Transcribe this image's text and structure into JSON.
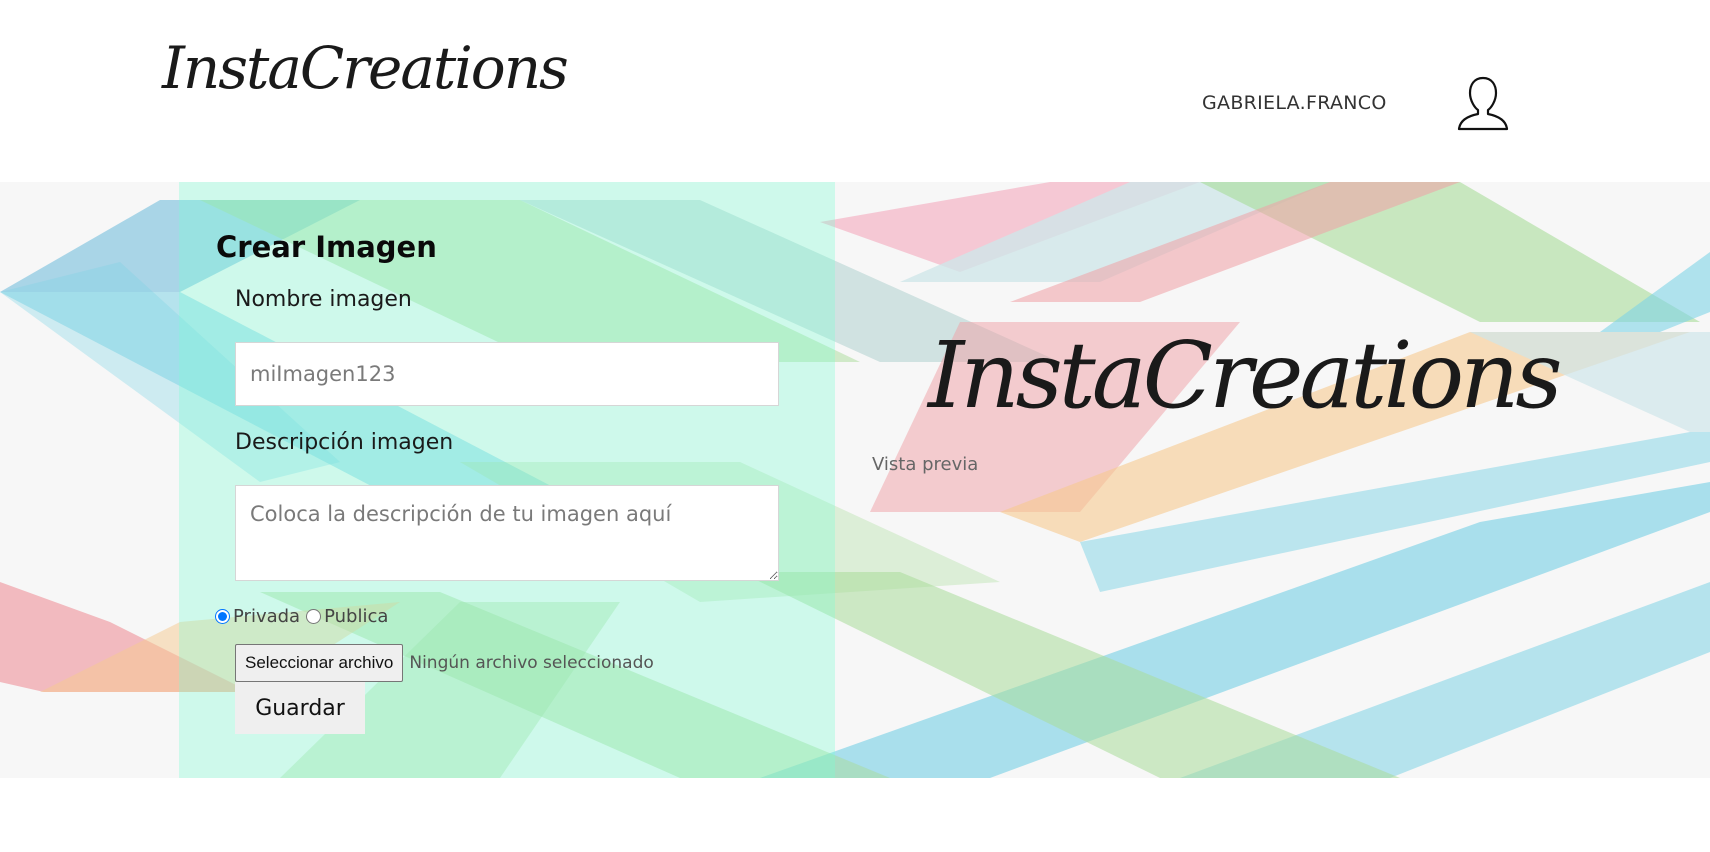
{
  "header": {
    "logo_text": "InstaCreations",
    "username": "GABRIELA.FRANCO",
    "avatar_icon": "user-silhouette-icon"
  },
  "form": {
    "title": "Crear Imagen",
    "name_label": "Nombre imagen",
    "name_placeholder": "miImagen123",
    "name_value": "",
    "description_label": "Descripción imagen",
    "description_placeholder": "Coloca la descripción de tu imagen aquí",
    "description_value": "",
    "visibility": {
      "options": [
        "Privada",
        "Publica"
      ],
      "selected": "Privada"
    },
    "file_button_label": "Seleccionar archivo",
    "file_status": "Ningún archivo seleccionado",
    "save_label": "Guardar"
  },
  "preview": {
    "logo_text": "InstaCreations",
    "label": "Vista previa"
  },
  "colors": {
    "form_panel_tint": "#78ffd2",
    "stripe_blue": "#7fd3e6",
    "stripe_green": "#a9dc9a",
    "stripe_red": "#f0a0a6",
    "stripe_orange": "#f6c98f"
  }
}
